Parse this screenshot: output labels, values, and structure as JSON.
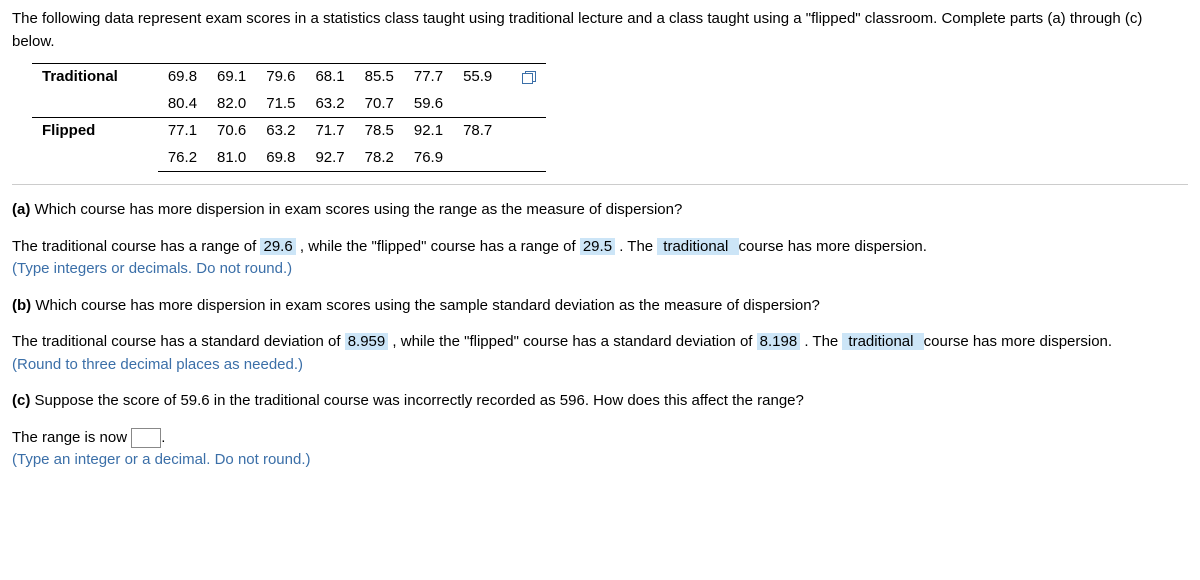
{
  "intro": "The following data represent exam scores in a statistics class taught using traditional lecture and a class taught using a \"flipped\" classroom. Complete parts (a) through (c) below.",
  "table": {
    "traditional_label": "Traditional",
    "flipped_label": "Flipped",
    "traditional": {
      "row1": [
        "69.8",
        "69.1",
        "79.6",
        "68.1",
        "85.5",
        "77.7",
        "55.9"
      ],
      "row2": [
        "80.4",
        "82.0",
        "71.5",
        "63.2",
        "70.7",
        "59.6",
        ""
      ]
    },
    "flipped": {
      "row1": [
        "77.1",
        "70.6",
        "63.2",
        "71.7",
        "78.5",
        "92.1",
        "78.7"
      ],
      "row2": [
        "76.2",
        "81.0",
        "69.8",
        "92.7",
        "78.2",
        "76.9",
        ""
      ]
    }
  },
  "a": {
    "label": "(a)",
    "question": " Which course has more dispersion in exam scores using the range as the measure of dispersion?",
    "text1": "The traditional course has a range of ",
    "ans1": "29.6",
    "text2": " , while the \"flipped\" course has a range of ",
    "ans2": "29.5",
    "text3": " . The ",
    "ans3": " traditional ",
    "text4": " course has more dispersion.",
    "instruction": "(Type integers or decimals. Do not round.)"
  },
  "b": {
    "label": "(b)",
    "question": " Which course has more dispersion in exam scores using the sample standard deviation as the measure of dispersion?",
    "text1": "The traditional course has a standard deviation of ",
    "ans1": "8.959",
    "text2": " , while the \"flipped\" course has a standard deviation of ",
    "ans2": "8.198",
    "text3": " . The ",
    "ans3": " traditional ",
    "text4": " course has more dispersion.",
    "instruction": "(Round to three decimal places as needed.)"
  },
  "c": {
    "label": "(c)",
    "question": " Suppose the score of 59.6 in the traditional course was incorrectly recorded as 596. How does this affect the range?",
    "text1": "The range is now ",
    "text2": ".",
    "instruction": "(Type an integer or a decimal. Do not round.)"
  }
}
